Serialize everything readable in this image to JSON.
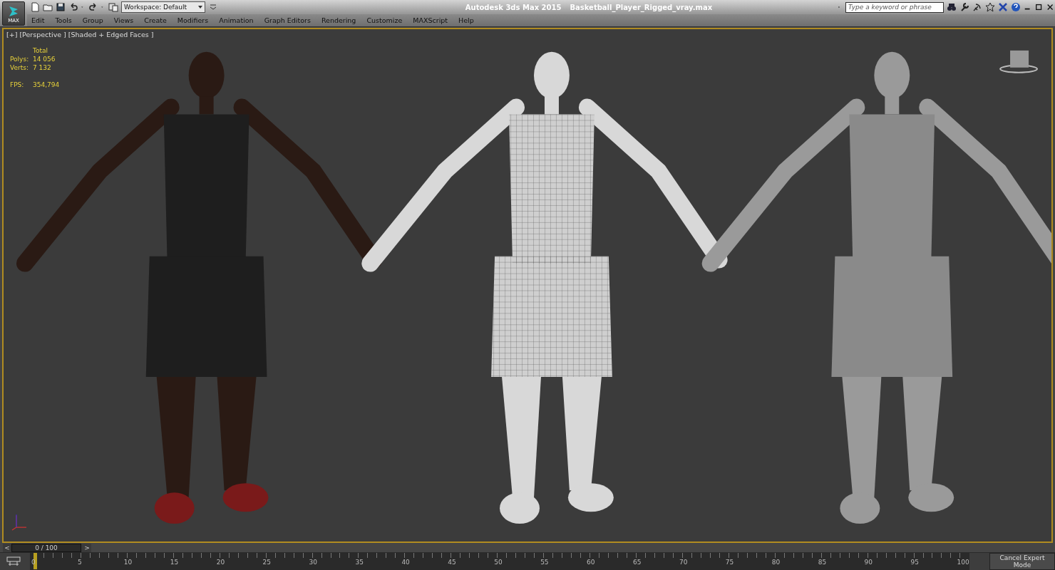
{
  "app_button": {
    "label": "MAX"
  },
  "workspace": {
    "value": "Workspace: Default"
  },
  "window": {
    "title": "Autodesk 3ds Max  2015",
    "file": "Basketball_Player_Rigged_vray.max"
  },
  "search": {
    "placeholder": "Type a keyword or phrase"
  },
  "menu": [
    "Edit",
    "Tools",
    "Group",
    "Views",
    "Create",
    "Modifiers",
    "Animation",
    "Graph Editors",
    "Rendering",
    "Customize",
    "MAXScript",
    "Help"
  ],
  "viewport": {
    "labels": [
      "[+]",
      "[Perspective ]",
      "[Shaded + Edged Faces ]"
    ],
    "stats": {
      "header": "Total",
      "rows": [
        {
          "label": "Polys:",
          "value": "14 056"
        },
        {
          "label": "Verts:",
          "value": "7 132"
        }
      ],
      "fps_label": "FPS:",
      "fps_value": "354,794"
    }
  },
  "time_slider": {
    "nav_left": "<",
    "reading": "0 / 100",
    "nav_right": ">",
    "level": 0
  },
  "track_bar": {
    "ticks": [
      "0",
      "5",
      "10",
      "15",
      "20",
      "25",
      "30",
      "35",
      "40",
      "45",
      "50",
      "55",
      "60",
      "65",
      "70",
      "75",
      "80",
      "85",
      "90",
      "95",
      "100"
    ]
  },
  "expert_button": "Cancel Expert Mode"
}
